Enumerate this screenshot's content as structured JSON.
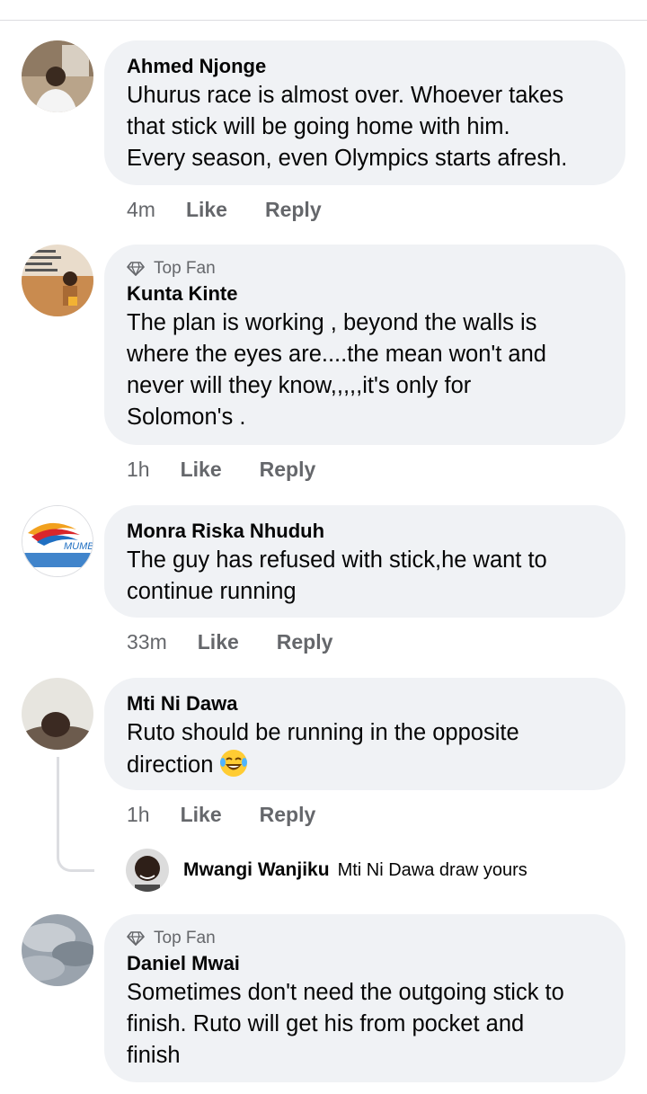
{
  "comments": [
    {
      "author": "Ahmed Njonge",
      "lines": [
        "Uhurus race is almost over. Whoever takes",
        "that stick  will be going home with him.",
        "Every season, even Olympics starts afresh."
      ],
      "time": "4m",
      "like": "Like",
      "reply": "Reply"
    },
    {
      "badge": "Top Fan",
      "author": "Kunta Kinte",
      "lines": [
        "The plan is working , beyond the walls is",
        "where the eyes are....the mean won't and",
        "never will they know,,,,,it's only for",
        "Solomon's ."
      ],
      "time": "1h",
      "like": "Like",
      "reply": "Reply"
    },
    {
      "author": "Monra Riska Nhuduh",
      "lines": [
        "The guy has refused with stick,he want to",
        "continue running"
      ],
      "time": "33m",
      "like": "Like",
      "reply": "Reply"
    },
    {
      "author": "Mti Ni Dawa",
      "lines": [
        "Ruto should be running in the opposite",
        "direction"
      ],
      "emoji": "laughing-tears-emoji",
      "time": "1h",
      "like": "Like",
      "reply": "Reply",
      "reply_preview": {
        "author": "Mwangi Wanjiku",
        "text": "Mti Ni Dawa draw yours"
      }
    },
    {
      "badge": "Top Fan",
      "author": "Daniel Mwai",
      "lines": [
        "Sometimes don't need the outgoing stick to",
        "finish. Ruto will get his from pocket and",
        "finish"
      ]
    }
  ],
  "icons": {
    "top_fan": "diamond-icon",
    "avatar3_text": "MUMBAI INDIANS"
  },
  "colors": {
    "bubble": "#f0f2f5",
    "meta_text": "#65676b",
    "primary_text": "#050505"
  }
}
